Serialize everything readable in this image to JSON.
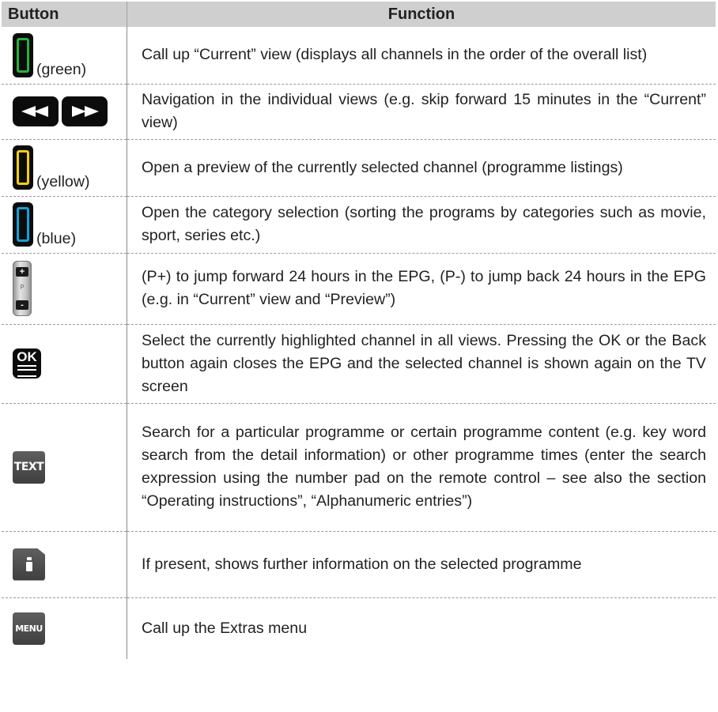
{
  "header": {
    "button": "Button",
    "function": "Function"
  },
  "rows": [
    {
      "icon": "green-button-icon",
      "caption": "(green)",
      "color": "#27b23a",
      "function": "Call up “Current” view (displays all channels in the order of the overall list)"
    },
    {
      "icon": "rewind-fastforward-buttons-icon",
      "function": "Navigation in the individual views (e.g. skip forward 15 minutes in the “Current” view)"
    },
    {
      "icon": "yellow-button-icon",
      "caption": "(yellow)",
      "color": "#f5d000",
      "function": "Open a preview of the currently selected channel (programme listings)"
    },
    {
      "icon": "blue-button-icon",
      "caption": "(blue)",
      "color": "#139fdc",
      "function": "Open the category selection (sorting the programs by categories such as movie, sport, series etc.)"
    },
    {
      "icon": "program-up-down-rocker-icon",
      "plus": "+",
      "minus": "-",
      "function": "(P+) to jump forward 24 hours in the EPG, (P-) to jump back 24 hours in the EPG (e.g. in “Current” view and “Preview”)"
    },
    {
      "icon": "ok-button-icon",
      "label": "OK",
      "function": "Select the currently highlighted channel in all views. Pressing the OK or the Back button again closes the EPG and the selected channel is shown again on the TV screen"
    },
    {
      "icon": "text-button-icon",
      "label": "TEXT",
      "function": "Search for a particular programme or certain programme content (e.g. key word search from the detail information) or other programme times (enter the search expression using the number pad on the remote control – see also the section “Operating instructions”, “Alphanumeric entries”)"
    },
    {
      "icon": "info-button-icon",
      "function": "If present, shows further information on the selected programme"
    },
    {
      "icon": "menu-button-icon",
      "label": "MENU",
      "function": "Call up the Extras menu"
    }
  ]
}
